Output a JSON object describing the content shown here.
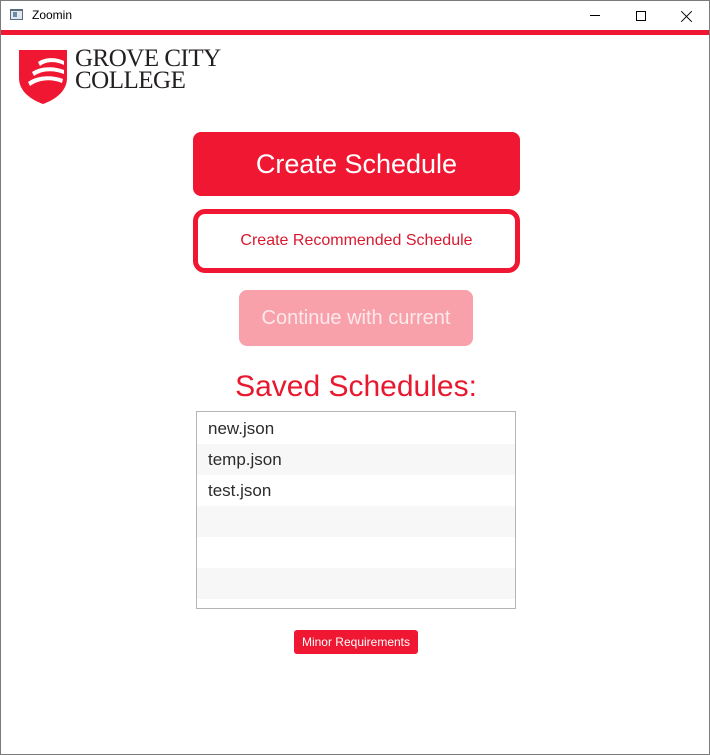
{
  "window": {
    "title": "Zoomin"
  },
  "colors": {
    "accent": "#ef1731",
    "disabled": "#f8a1ab"
  },
  "logo": {
    "line1": "GROVE CITY",
    "line2": "COLLEGE"
  },
  "buttons": {
    "create_schedule": "Create Schedule",
    "create_recommended": "Create Recommended Schedule",
    "continue_current": "Continue with current",
    "minor_requirements": "Minor Requirements"
  },
  "saved": {
    "heading": "Saved Schedules:",
    "files": [
      "new.json",
      "temp.json",
      "test.json",
      "",
      "",
      ""
    ]
  }
}
